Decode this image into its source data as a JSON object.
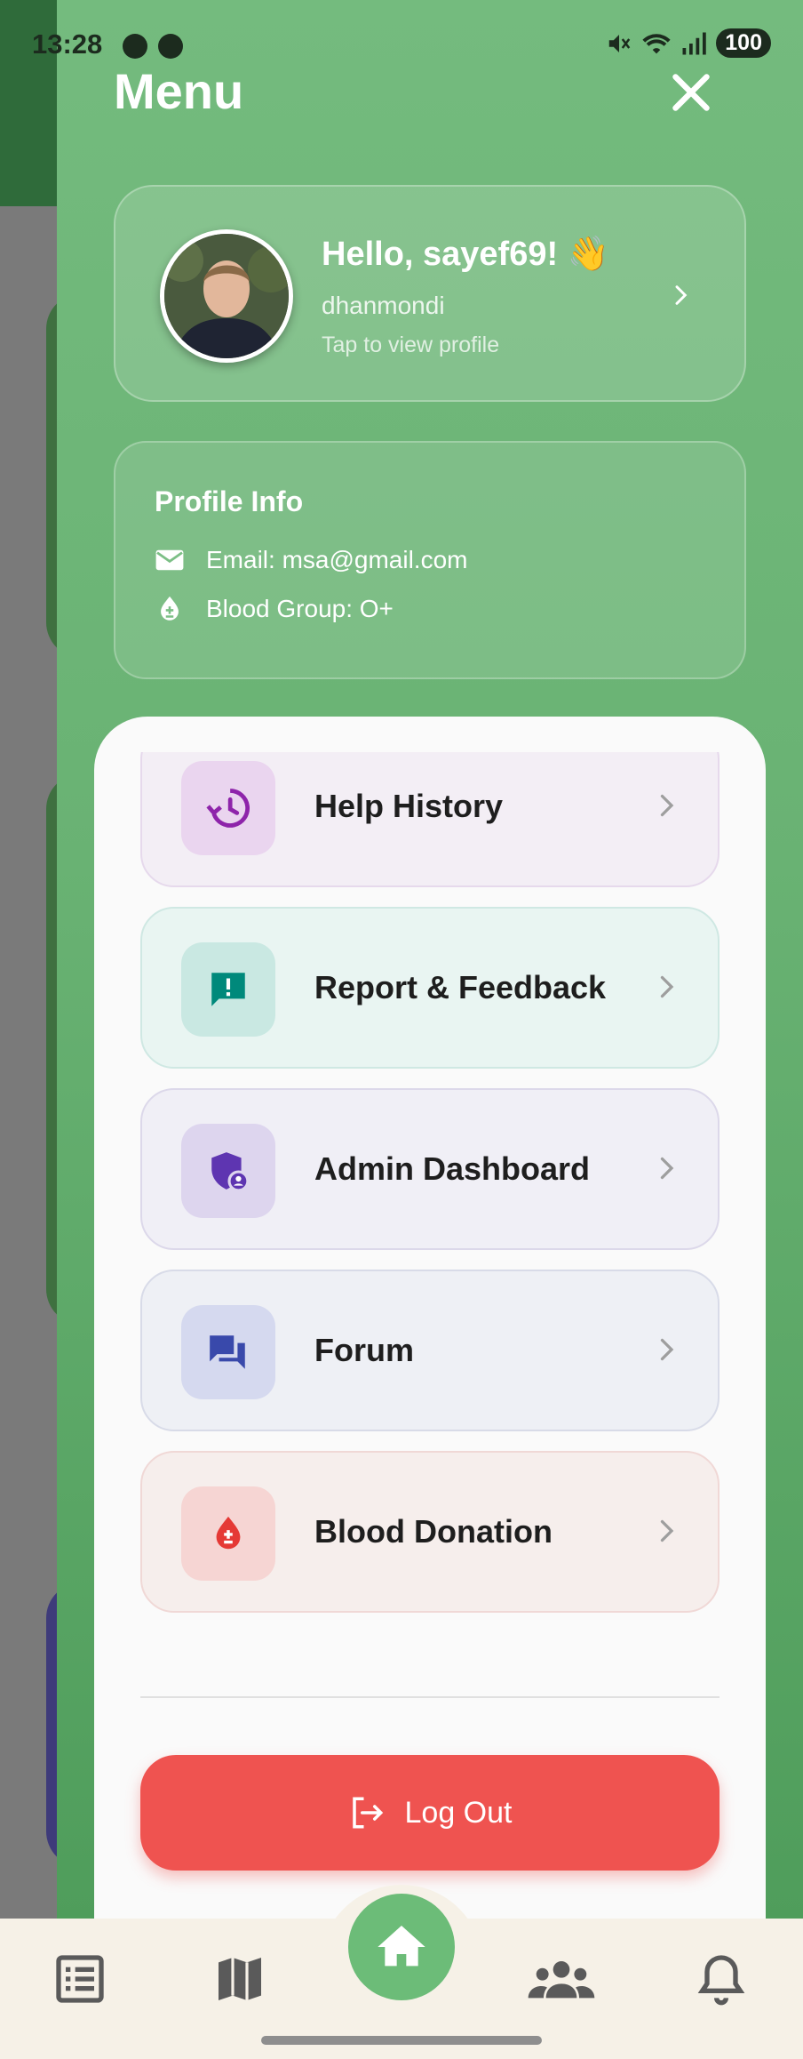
{
  "status_bar": {
    "time": "13:28",
    "battery": "100"
  },
  "drawer": {
    "title": "Menu"
  },
  "profile": {
    "greeting": "Hello, sayef69! 👋",
    "location": "dhanmondi",
    "hint": "Tap to view profile"
  },
  "profile_info": {
    "title": "Profile Info",
    "email": "Email: msa@gmail.com",
    "blood_group": "Blood Group: O+"
  },
  "menu_items": [
    {
      "label": "Help History",
      "icon": "history-icon",
      "accent": "#8e24aa",
      "bg": "#f3eef5",
      "border": "#e6d9ec",
      "icon_bg": "#ead5ef"
    },
    {
      "label": "Report & Feedback",
      "icon": "feedback-icon",
      "accent": "#00897b",
      "bg": "#e9f5f2",
      "border": "#cfe8e3",
      "icon_bg": "#c9e8e2"
    },
    {
      "label": "Admin Dashboard",
      "icon": "admin-shield-icon",
      "accent": "#5e35b1",
      "bg": "#f0eff6",
      "border": "#dcd8ea",
      "icon_bg": "#ddd5ee"
    },
    {
      "label": "Forum",
      "icon": "forum-icon",
      "accent": "#3949ab",
      "bg": "#eef0f5",
      "border": "#d8dbe8",
      "icon_bg": "#d5d9ef"
    },
    {
      "label": "Blood Donation",
      "icon": "blood-drop-icon",
      "accent": "#e53935",
      "bg": "#f6eeec",
      "border": "#f0d8d6",
      "icon_bg": "#f6d5d3"
    }
  ],
  "logout": {
    "label": "Log Out"
  },
  "bottom_nav": [
    "list-icon",
    "map-icon",
    "home-icon",
    "group-icon",
    "bell-icon"
  ],
  "colors": {
    "primary_green": "#6cbc78",
    "logout_red": "#ef5350"
  }
}
